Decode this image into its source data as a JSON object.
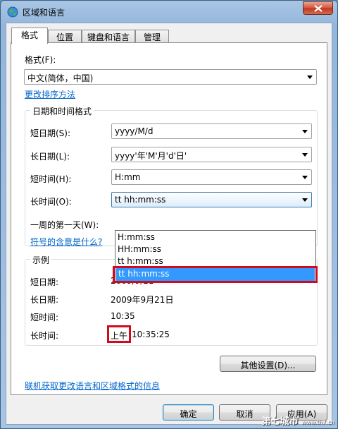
{
  "window": {
    "title": "区域和语言"
  },
  "tabs": [
    {
      "label": "格式"
    },
    {
      "label": "位置"
    },
    {
      "label": "键盘和语言"
    },
    {
      "label": "管理"
    }
  ],
  "format": {
    "label": "格式(F):",
    "value": "中文(简体，中国)",
    "sort_link": "更改排序方法"
  },
  "datetime": {
    "group_title": "日期和时间格式",
    "short_date": {
      "label": "短日期(S):",
      "value": "yyyy/M/d"
    },
    "long_date": {
      "label": "长日期(L):",
      "value": "yyyy'年'M'月'd'日'"
    },
    "short_time": {
      "label": "短时间(H):",
      "value": "H:mm"
    },
    "long_time": {
      "label": "长时间(O):",
      "value": "tt hh:mm:ss"
    },
    "first_day": {
      "label": "一周的第一天(W):"
    },
    "symbols_link": "符号的含意是什么?",
    "options": [
      "H:mm:ss",
      "HH:mm:ss",
      "tt h:mm:ss",
      "tt hh:mm:ss"
    ]
  },
  "example": {
    "group_title": "示例",
    "rows": [
      {
        "label": "短日期:",
        "value": "2009/9/21"
      },
      {
        "label": "长日期:",
        "value": "2009年9月21日"
      },
      {
        "label": "短时间:",
        "value": "10:35"
      },
      {
        "label": "长时间:",
        "prefix": "上午",
        "value": "10:35:25"
      }
    ]
  },
  "other_settings_button": "其他设置(D)...",
  "online_link": "联机获取更改语言和区域格式的信息",
  "buttons": {
    "ok": "确定",
    "cancel": "取消",
    "apply": "应用(A)"
  },
  "watermark": {
    "text": "第七城市",
    "sub": "www.th7.cn"
  },
  "colors": {
    "link": "#0066cc",
    "selection": "#3399ff",
    "highlight_box": "#d20a1e"
  }
}
